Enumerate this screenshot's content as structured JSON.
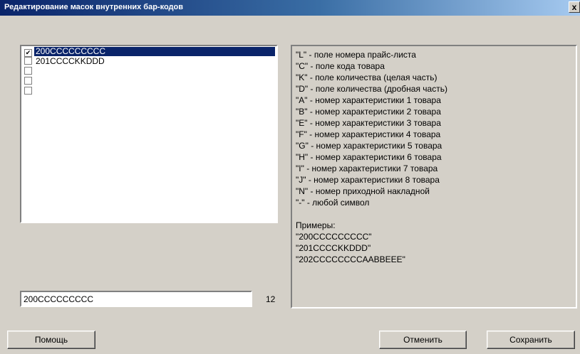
{
  "window": {
    "title": "Редактирование масок внутренних бар-кодов",
    "close_label": "x"
  },
  "mask_list": {
    "items": [
      {
        "label": "200CCCCCCCCC",
        "checked": true,
        "selected": true
      },
      {
        "label": "201CCCCKKDDD",
        "checked": false,
        "selected": false
      },
      {
        "label": "",
        "checked": false,
        "selected": false
      },
      {
        "label": "",
        "checked": false,
        "selected": false
      },
      {
        "label": "",
        "checked": false,
        "selected": false
      }
    ]
  },
  "mask_input": {
    "value": "200CCCCCCCCC",
    "length_counter": "12"
  },
  "help": {
    "lines": [
      "\"L\" - поле номера прайс-листа",
      "\"C\" - поле кода товара",
      "\"K\" - поле количества (целая часть)",
      "\"D\" - поле количества (дробная часть)",
      "\"A\" - номер характеристики 1 товара",
      "\"B\" - номер характеристики 2 товара",
      "\"E\" - номер характеристики 3 товара",
      "\"F\" - номер характеристики 4 товара",
      "\"G\" - номер характеристики 5 товара",
      "\"H\" - номер характеристики 6 товара",
      "\"I\" - номер характеристики 7 товара",
      "\"J\" - номер характеристики 8 товара",
      "\"N\" - номер приходной накладной",
      "\"-\" - любой символ",
      "",
      "Примеры:",
      "\"200CCCCCCCCC\"",
      "\"201CCCCKKDDD\"",
      "\"202CCCCCCCCAABBEEE\""
    ]
  },
  "buttons": {
    "help": "Помощь",
    "cancel": "Отменить",
    "save": "Сохранить"
  }
}
